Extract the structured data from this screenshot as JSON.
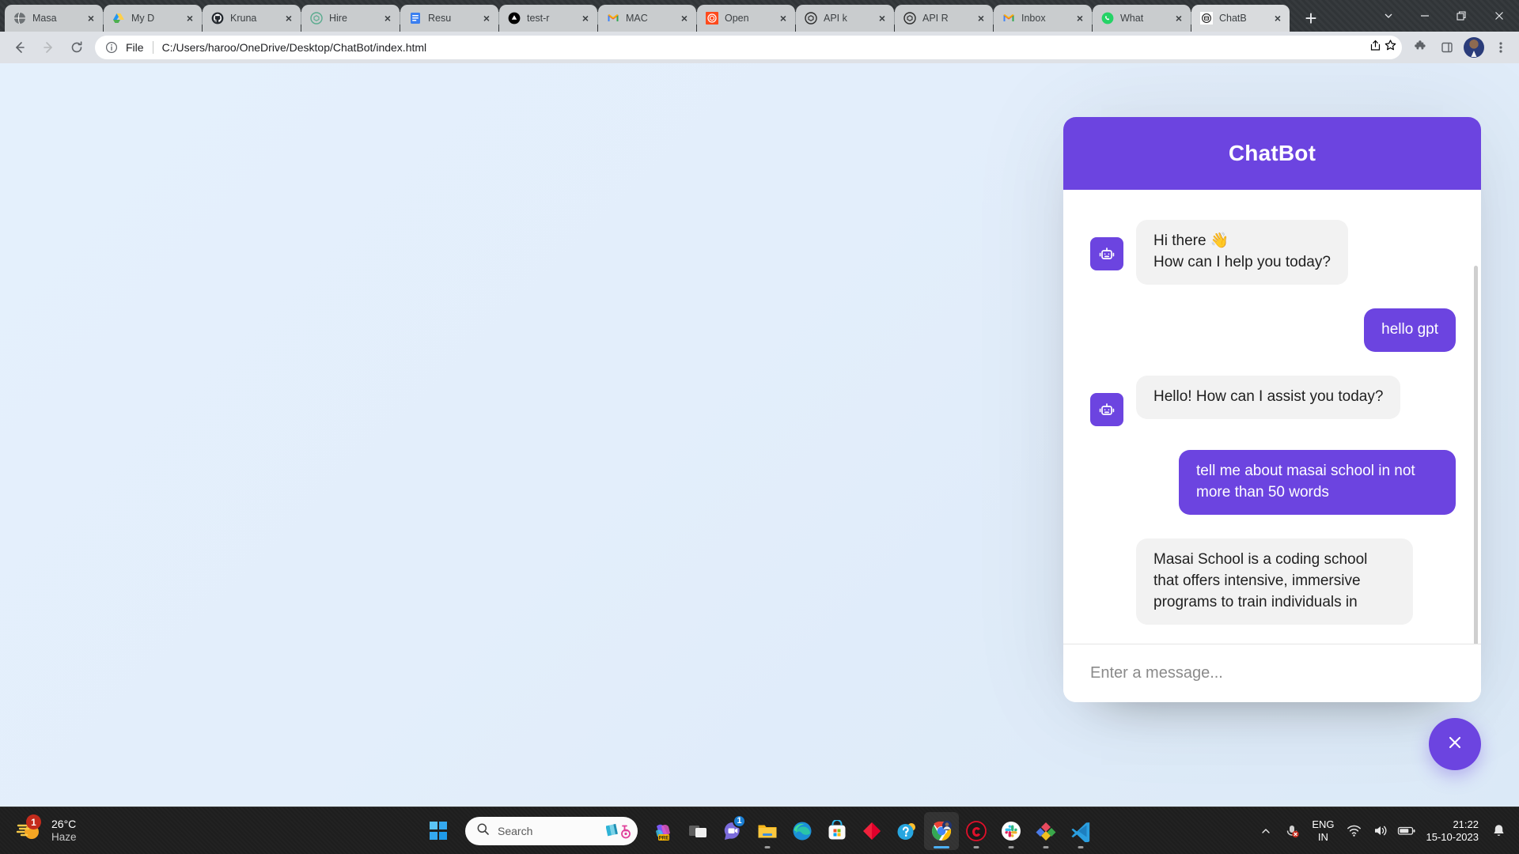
{
  "browser": {
    "tabs": [
      {
        "label": "Masa",
        "icon": "globe-icon"
      },
      {
        "label": "My D",
        "icon": "google-drive-icon"
      },
      {
        "label": "Kruna",
        "icon": "github-icon"
      },
      {
        "label": "Hire ",
        "icon": "openai-icon"
      },
      {
        "label": "Resu",
        "icon": "document-icon"
      },
      {
        "label": "test-r",
        "icon": "vercel-icon"
      },
      {
        "label": "MAC",
        "icon": "gmail-icon"
      },
      {
        "label": "Open",
        "icon": "chatgpt-icon"
      },
      {
        "label": "API k",
        "icon": "openai-icon"
      },
      {
        "label": "API R",
        "icon": "openai-icon"
      },
      {
        "label": "Inbox",
        "icon": "gmail-icon"
      },
      {
        "label": "What",
        "icon": "whatsapp-icon"
      },
      {
        "label": "ChatB",
        "icon": "chatbot-icon",
        "active": true
      }
    ],
    "new_tab_label": "+",
    "close_tab_label": "×",
    "window_controls": {
      "tab_search": "tab-search-chevron",
      "minimize": "minimize",
      "maximize": "restore",
      "close": "close"
    },
    "toolbar": {
      "back": "back-arrow",
      "forward": "forward-arrow",
      "reload": "reload-arrow",
      "scheme_label": "File",
      "url": "C:/Users/haroo/OneDrive/Desktop/ChatBot/index.html",
      "share": "share-icon",
      "bookmark": "bookmark-star-icon",
      "extensions": "puzzle-icon",
      "side_panel": "side-panel-icon",
      "profile": "profile-avatar",
      "menu": "three-dot-menu-icon"
    }
  },
  "chatbot": {
    "title": "ChatBot",
    "avatar_icon": "robot-icon",
    "messages": [
      {
        "role": "bot",
        "text": "Hi there 👋\nHow can I help you today?"
      },
      {
        "role": "user",
        "text": "hello gpt"
      },
      {
        "role": "bot",
        "text": "Hello! How can I assist you today?"
      },
      {
        "role": "user",
        "text": "tell me about masai school in not more than 50 words"
      },
      {
        "role": "bot",
        "text": "Masai School is a coding school that offers intensive, immersive programs to train individuals in"
      }
    ],
    "input": {
      "value": "",
      "placeholder": "Enter a message..."
    },
    "toggle_icon": "close-icon",
    "accent_color": "#6c44e0",
    "bot_bubble_color": "#f2f2f2"
  },
  "taskbar": {
    "weather": {
      "temperature": "26°C",
      "condition": "Haze",
      "badge": "1",
      "icon": "haze-sun-icon"
    },
    "start": {
      "icon": "windows-logo-icon"
    },
    "search": {
      "placeholder": "Search",
      "icon": "search-icon",
      "thumb_icon": "wheelchair-image-thumb"
    },
    "apps": [
      {
        "name": "copilot-pre",
        "label": "PRE"
      },
      {
        "name": "task-view"
      },
      {
        "name": "teams",
        "badge": "1"
      },
      {
        "name": "file-explorer",
        "running": true
      },
      {
        "name": "microsoft-edge"
      },
      {
        "name": "microsoft-store"
      },
      {
        "name": "red-diamond-app"
      },
      {
        "name": "get-help"
      },
      {
        "name": "google-chrome",
        "active": true,
        "running": true
      },
      {
        "name": "red-circle-app",
        "running": true
      },
      {
        "name": "slack",
        "running": true
      },
      {
        "name": "colorful-diamond-app",
        "running": true
      },
      {
        "name": "visual-studio-code",
        "running": true
      }
    ],
    "tray": {
      "chevron": "show-hidden-icons-chevron",
      "mic_muted": "mic-muted-icon",
      "language_primary": "ENG",
      "language_secondary": "IN",
      "wifi": "wifi-icon",
      "volume": "volume-icon",
      "battery": "battery-icon",
      "time": "21:22",
      "date": "15-10-2023",
      "notifications": "bell-icon"
    }
  }
}
